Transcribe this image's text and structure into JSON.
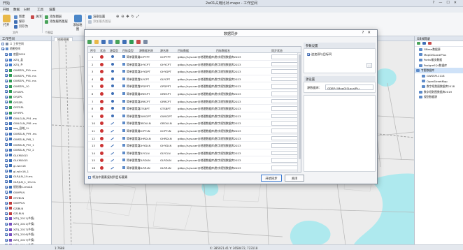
{
  "window": {
    "title": "2w01占用比对.mapx - 工作空间",
    "left_label": "开始",
    "controls": [
      "?",
      "—",
      "☐",
      "✕"
    ]
  },
  "menu": [
    "开始",
    "数据",
    "分析",
    "工具",
    "设置"
  ],
  "ribbon": {
    "open": "打开",
    "new": "新建",
    "save": "保存",
    "save_as": "另存为",
    "close": "关闭",
    "group_file": "文件",
    "add_layer": "添加图层",
    "add_service_layer": "添加服务图层",
    "add_map": "添加地图",
    "group_layer": "个图层",
    "add_map_layer": "添加地图",
    "visible": "可见",
    "group_label": "标注",
    "hint": "渲染设置",
    "hint2": "添加服务图层"
  },
  "left_panel": {
    "title": "工作空间",
    "items": [
      {
        "label": "☐ 工作空间",
        "checked": false,
        "color": "#7a8aa3"
      },
      {
        "label": "地图空间",
        "checked": true,
        "color": "#5d8bc9"
      },
      {
        "label": "底图2020",
        "checked": true,
        "color": "#5d8bc9"
      },
      {
        "label": "XZQ_县",
        "checked": true,
        "color": "#3d7bd1"
      },
      {
        "label": "XZQ_乡",
        "checked": true,
        "color": "#3d7bd1"
      },
      {
        "label": "GWSSPL_PY9 .ms",
        "checked": true,
        "color": "#2e9b55"
      },
      {
        "label": "GWSSPL_PY8 .ms",
        "checked": true,
        "color": "#2e9b55"
      },
      {
        "label": "GWSSPL_PY4 .ms",
        "checked": true,
        "color": "#2e9b55"
      },
      {
        "label": "GWSSPL_10",
        "checked": true,
        "color": "#2e9b55"
      },
      {
        "label": "GYGSPL",
        "checked": true,
        "color": "#2e9b55"
      },
      {
        "label": "GYJZPL",
        "checked": true,
        "color": "#2e9b55"
      },
      {
        "label": "GYSSPL",
        "checked": true,
        "color": "#2e9b55"
      },
      {
        "label": "GYZGPL",
        "checked": true,
        "color": "#2e9b55"
      },
      {
        "label": "GYHYPL",
        "checked": true,
        "color": "#2e9b55"
      },
      {
        "label": "GWLGLN_PY4 .ms",
        "checked": true,
        "color": "#3a6fb7"
      },
      {
        "label": "GWLGLN_PY8 .ms",
        "checked": true,
        "color": "#3a6fb7"
      },
      {
        "label": "xzq_县域_1L",
        "checked": true,
        "color": "#3a6fb7"
      },
      {
        "label": "GWSSLN_PY9 .ms",
        "checked": true,
        "color": "#3a6fb7"
      },
      {
        "label": "GWSSLN_PY8_1",
        "checked": true,
        "color": "#3a6fb7"
      },
      {
        "label": "GWSSLN_PY2_1",
        "checked": true,
        "color": "#3a6fb7"
      },
      {
        "label": "GWSSLN_PY2_2",
        "checked": true,
        "color": "#3a6fb7"
      },
      {
        "label": "GLXMLN13",
        "checked": true,
        "color": "#3a6fb7"
      },
      {
        "label": "GLXMLN15",
        "checked": true,
        "color": "#3a6fb7"
      },
      {
        "label": "gl-rslin16",
        "checked": true,
        "color": "#3a6fb7"
      },
      {
        "label": "gl-rslin16_1",
        "checked": true,
        "color": "#3a6fb7"
      },
      {
        "label": "GLRJLN_19-ms",
        "checked": true,
        "color": "#3a6fb7"
      },
      {
        "label": "GLRJLN_1_19-ms",
        "checked": true,
        "color": "#3a6fb7"
      },
      {
        "label": "规划线ll-cms18",
        "checked": true,
        "color": "#3a6fb7"
      },
      {
        "label": "GWYPLN",
        "checked": true,
        "color": "#3a6fb7"
      },
      {
        "label": "GTZBLN",
        "checked": true,
        "color": "#c23c3c"
      },
      {
        "label": "GWYPLN",
        "checked": true,
        "color": "#c23c3c"
      },
      {
        "label": "GZJBLN",
        "checked": true,
        "color": "#c23c3c"
      },
      {
        "label": "GZLRLN",
        "checked": true,
        "color": "#c23c3c"
      },
      {
        "label": "XZQ_2011(乡镇)",
        "checked": true,
        "color": "#7a4fbf"
      },
      {
        "label": "XZQ_2011(乡镇)",
        "checked": true,
        "color": "#7a4fbf"
      },
      {
        "label": "XZQ_2017(乡镇)",
        "checked": true,
        "color": "#7a4fbf"
      },
      {
        "label": "XZQ_2016(乡镇)",
        "checked": true,
        "color": "#7a4fbf"
      },
      {
        "label": "XZQ_2017(乡镇)",
        "checked": true,
        "color": "#7a4fbf"
      },
      {
        "label": "XZQ_2014(乡镇)",
        "checked": true,
        "color": "#7a4fbf"
      }
    ]
  },
  "map": {
    "tab": "地图视图"
  },
  "right_panel": {
    "title": "GBN目录",
    "items": [
      {
        "label": "GBase数据源",
        "indent": 1,
        "selected": false
      },
      {
        "label": "MapGISLocalPlus",
        "indent": 1,
        "selected": false
      },
      {
        "label": "Portal服务数据",
        "indent": 1,
        "selected": false
      },
      {
        "label": "PostgreSQL数据库",
        "indent": 1,
        "selected": false
      },
      {
        "label": "专题数据库",
        "indent": 0,
        "selected": true
      },
      {
        "label": "GWSSPL1118",
        "indent": 2,
        "selected": false
      },
      {
        "label": "OpenStreetMap",
        "indent": 2,
        "selected": false
      },
      {
        "label": "数字规划图数据库2018",
        "indent": 2,
        "selected": false
      },
      {
        "label": "数字规划图数据库2019",
        "indent": 1,
        "selected": false
      },
      {
        "label": "规划数据源",
        "indent": 1,
        "selected": false
      }
    ]
  },
  "status": {
    "scale": "1:7688",
    "coords": "X: 385021.41  Y: 3658472, 723118"
  },
  "dialog": {
    "title": "数据同步",
    "controls": [
      "?",
      "✕"
    ],
    "toolbar_icons": [
      "add-icon",
      "folder-icon",
      "refresh-icon",
      "copy-icon",
      "select-icon",
      "export-icon",
      "edit-icon",
      "delete-icon",
      "settings-icon"
    ],
    "columns": [
      "序号",
      "状态",
      "源类型",
      "目标类型",
      "源数据名称",
      "源名称",
      "目标数据",
      "目标数据名",
      "同步状态"
    ],
    "rows": [
      {
        "n": "1",
        "status": "#cc3333",
        "geo": "pt",
        "type": "简单要素类",
        "src": "GCPTPT",
        "dst": "GCPTPT",
        "path": "gdbp://sysuser@地理数据库/数字规划数据库2023"
      },
      {
        "n": "2",
        "status": "#cc3333",
        "geo": "pt",
        "type": "简单要素类",
        "src": "GHYCPT",
        "dst": "GHYCPT",
        "path": "gdbp://sysuser@地理数据库/数字规划数据库2023"
      },
      {
        "n": "3",
        "status": "#cc3333",
        "geo": "pt",
        "type": "简单要素类",
        "src": "GHYDPT",
        "dst": "GHYDPT",
        "path": "gdbp://sysuser@地理数据库/数字规划数据库2023"
      },
      {
        "n": "4",
        "status": "#cc3333",
        "geo": "pt",
        "type": "简单要素类",
        "src": "GLYCPT",
        "dst": "GLYCPT",
        "path": "gdbp://sysuser@地理数据库/数字规划数据库2023"
      },
      {
        "n": "5",
        "status": "#cc3333",
        "geo": "pt",
        "type": "简单要素类",
        "src": "GPDPPT",
        "dst": "GPDPPT",
        "path": "gdbp://sysuser@地理数据库/数字规划数据库2023"
      },
      {
        "n": "6",
        "status": "#cc3333",
        "geo": "pt",
        "type": "简单要素类",
        "src": "GRESPT",
        "dst": "GRESPT",
        "path": "gdbp://sysuser@地理数据库/数字规划数据库2023"
      },
      {
        "n": "7",
        "status": "#cc3333",
        "geo": "pt",
        "type": "简单要素类",
        "src": "GRRCPT",
        "dst": "GRRCPT",
        "path": "gdbp://sysuser@地理数据库/数字规划数据库2023"
      },
      {
        "n": "8",
        "status": "#cc3333",
        "geo": "pt",
        "type": "简单要素类",
        "src": "GTSBPT",
        "dst": "GTSBPT",
        "path": "gdbp://sysuser@地理数据库/数字规划数据库2023"
      },
      {
        "n": "9",
        "status": "#cc3333",
        "geo": "pt",
        "type": "简单要素类",
        "src": "GWSGPT",
        "dst": "GWSGPT",
        "path": "gdbp://sysuser@地理数据库/数字规划数据库2023"
      },
      {
        "n": "10",
        "status": "#cc3333",
        "geo": "ln",
        "type": "简单要素类",
        "src": "GBOULN",
        "dst": "GBOULN",
        "path": "gdbp://sysuser@地理数据库/数字规划数据库2023"
      },
      {
        "n": "11",
        "status": "#cc3333",
        "geo": "ln",
        "type": "简单要素类",
        "src": "GCPTLN",
        "dst": "GCPTLN",
        "path": "gdbp://sysuser@地理数据库/数字规划数据库2023"
      },
      {
        "n": "12",
        "status": "#cc3333",
        "geo": "ln",
        "type": "简单要素类",
        "src": "GHRDLN",
        "dst": "GHRDLN",
        "path": "gdbp://sysuser@地理数据库/数字规划数据库2023"
      },
      {
        "n": "13",
        "status": "#cc3333",
        "geo": "ln",
        "type": "简单要素类",
        "src": "GHYDLN",
        "dst": "GHYDLN",
        "path": "gdbp://sysuser@地理数据库/数字规划数据库2023"
      },
      {
        "n": "14",
        "status": "#cc3333",
        "geo": "ln",
        "type": "简单要素类",
        "src": "GLYCLN",
        "dst": "GLYCLN",
        "path": "gdbp://sysuser@地理数据库/数字规划数据库2023"
      },
      {
        "n": "15",
        "status": "#cc3333",
        "geo": "ln",
        "type": "简单要素类",
        "src": "GLRDLN",
        "dst": "GLRDLN",
        "path": "gdbp://sysuser@地理数据库/数字规划数据库2023"
      },
      {
        "n": "16",
        "status": "#cc3333",
        "geo": "ln",
        "type": "简单要素类",
        "src": "GLRRLN",
        "dst": "GLRRLN",
        "path": "gdbp://sysuser@地理数据库/数字规划数据库2023"
      },
      {
        "n": "17",
        "status": "#cc3333",
        "geo": "ln",
        "type": "简单要素类",
        "src": "GPIPLN",
        "dst": "GPIPLN",
        "path": "gdbp://sysuser@地理数据库/数字规划数据库2023"
      }
    ],
    "param_header": "参数设置",
    "checkbox_label": "追加源与目标同",
    "checkbox_checked": true,
    "log_header": "源设置",
    "db_label": "源数据库：",
    "db_value": "GDBP://MapGISLocalPlu",
    "footer_checkbox": "将选中要素复制到目标要素",
    "btn_start": "开始同步",
    "btn_close": "关闭"
  }
}
